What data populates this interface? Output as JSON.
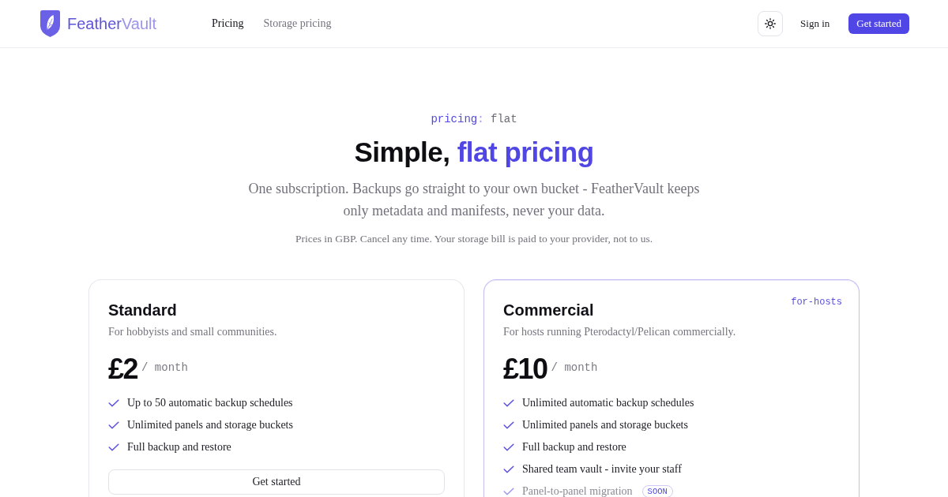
{
  "header": {
    "brand": {
      "name_start": "Feather",
      "name_end": "Vault"
    },
    "nav": [
      {
        "label": "Pricing",
        "selected": true
      },
      {
        "label": "Storage pricing",
        "selected": false
      }
    ],
    "sign_in": "Sign in",
    "cta": "Get started"
  },
  "hero": {
    "eyebrow": {
      "key": "pricing",
      "separator": ":",
      "value": "flat"
    },
    "title": {
      "start": "Simple,",
      "highlight": "flat pricing"
    },
    "subtitle": "One subscription. Backups go straight to your own bucket - FeatherVault keeps only metadata and manifests, never your data.",
    "note": "Prices in GBP. Cancel any time. Your storage bill is paid to your provider, not to us."
  },
  "plans": [
    {
      "name": "Standard",
      "featured": false,
      "description": "For hobbyists and small communities.",
      "price": "£2",
      "period": "/ month",
      "features": [
        {
          "text": "Up to 50 automatic backup schedules",
          "available": true
        },
        {
          "text": "Unlimited panels and storage buckets",
          "available": true
        },
        {
          "text": "Full backup and restore",
          "available": true
        }
      ],
      "button": "Get started"
    },
    {
      "name": "Commercial",
      "featured": true,
      "tag": "for-hosts",
      "description": "For hosts running Pterodactyl/Pelican commercially.",
      "price": "£10",
      "period": "/ month",
      "features": [
        {
          "text": "Unlimited automatic backup schedules",
          "available": true
        },
        {
          "text": "Unlimited panels and storage buckets",
          "available": true
        },
        {
          "text": "Full backup and restore",
          "available": true
        },
        {
          "text": "Shared team vault - invite your staff",
          "available": true
        },
        {
          "text": "Panel-to-panel migration",
          "available": false,
          "badge": "SOON"
        }
      ]
    }
  ]
}
